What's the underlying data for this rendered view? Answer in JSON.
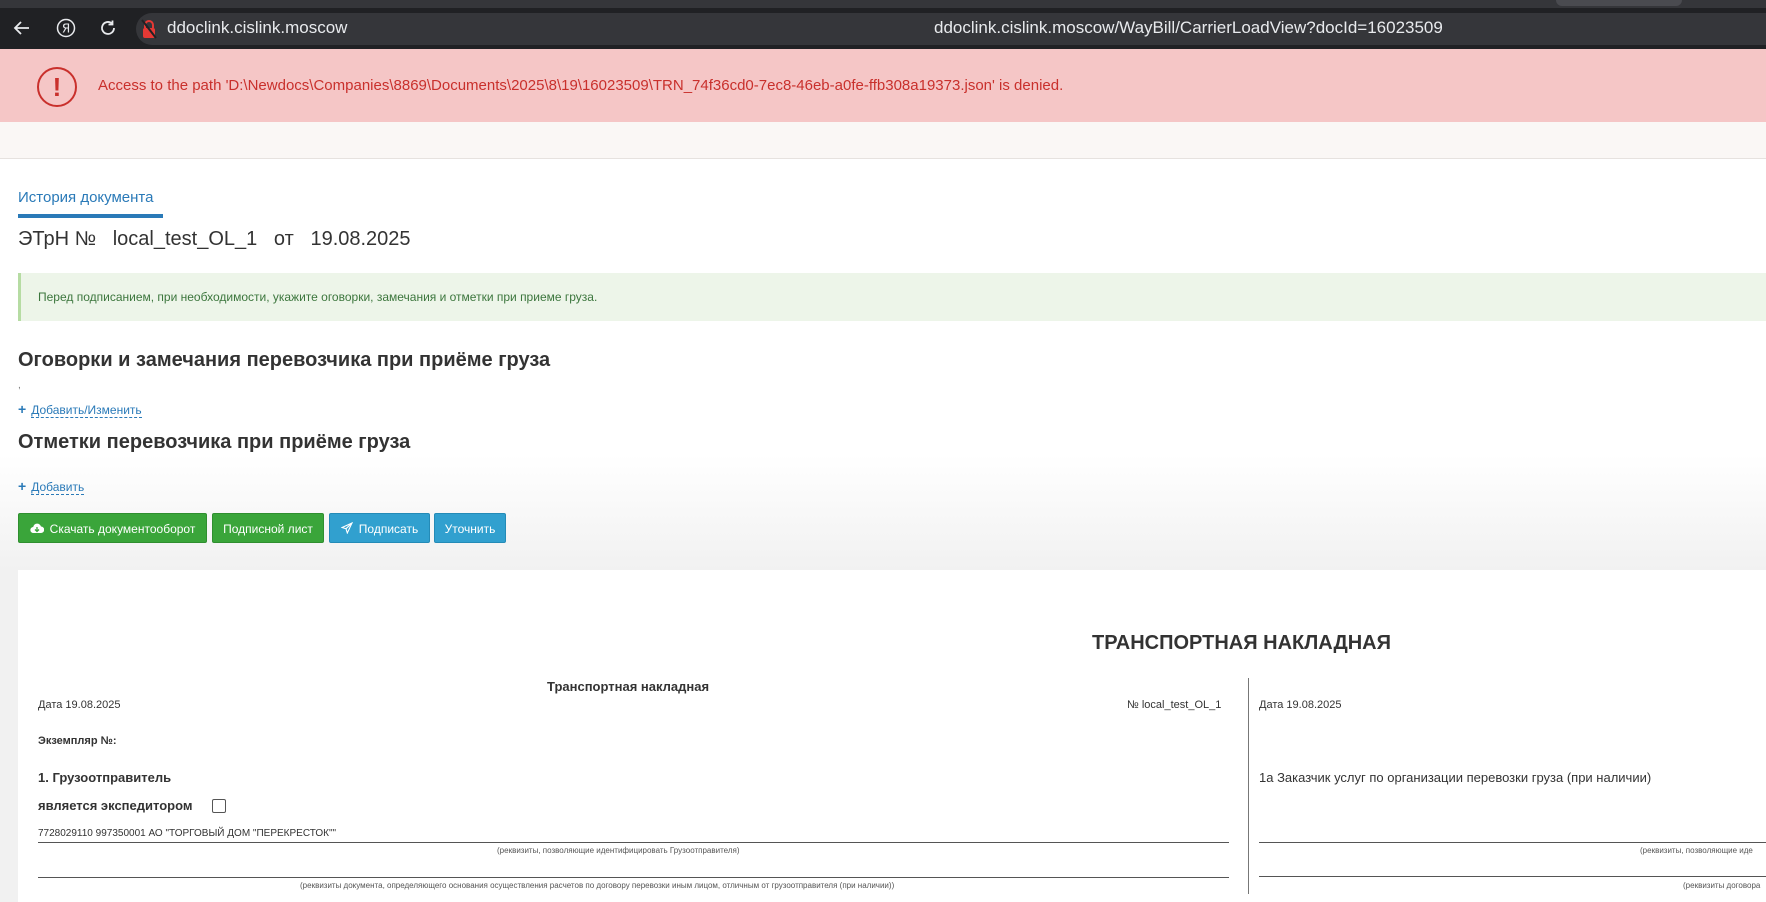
{
  "browser": {
    "host": "ddoclink.cislink.moscow",
    "url": "ddoclink.cislink.moscow/WayBill/CarrierLoadView?docId=16023509",
    "back_icon": "arrow-left-icon",
    "yandex_icon": "yandex-logo-icon",
    "reload_icon": "reload-icon"
  },
  "error": {
    "message": "Access to the path 'D:\\Newdocs\\Companies\\8869\\Documents\\2025\\8\\19\\16023509\\TRN_74f36cd0-7ec8-46eb-a0fe-ffb308a19373.json' is denied.",
    "color": "#c9302c"
  },
  "page": {
    "history_tab": "История документа",
    "doc_title": "ЭТрН №   local_test_OL_1   от   19.08.2025",
    "notice": "Перед подписанием, при необходимости, укажите оговорки, замечания и отметки при приеме груза.",
    "remarks_heading": "Оговорки и замечания перевозчика при приёме груза",
    "remarks_value": ",",
    "remarks_link": "Добавить/Изменить",
    "marks_heading": "Отметки перевозчика при приёме груза",
    "marks_link": "Добавить",
    "buttons": {
      "download": "Скачать документооборот",
      "sheet": "Подписной лист",
      "sign": "Подписать",
      "clarify": "Уточнить"
    }
  },
  "document": {
    "heading": "ТРАНСПОРТНАЯ НАКЛАДНАЯ",
    "subheading": "Транспортная накладная",
    "date_left": "Дата  19.08.2025",
    "number": "№   local_test_OL_1",
    "date_right": "Дата 19.08.2025",
    "copy_no": "Экземпляр №:",
    "shipper_label": "1. Грузоотправитель",
    "forwarder_label": "является экспедитором",
    "shipper_requisites": "7728029110 997350001 АО \"ТОРГОВЫЙ ДОМ \"ПЕРЕКРЕСТОК\"\"",
    "caption1": "(реквизиты, позволяющие идентифицировать Грузоотправителя)",
    "caption2": "(реквизиты документа, определяющего основания осуществления расчетов по договору перевозки иным лицом, отличным от грузоотправителя (при наличии))",
    "customer_label": "1а Заказчик услуг по организации перевозки груза (при наличии)",
    "caption3": "(реквизиты, позволяющие иде",
    "caption4": "(реквизиты договора"
  }
}
